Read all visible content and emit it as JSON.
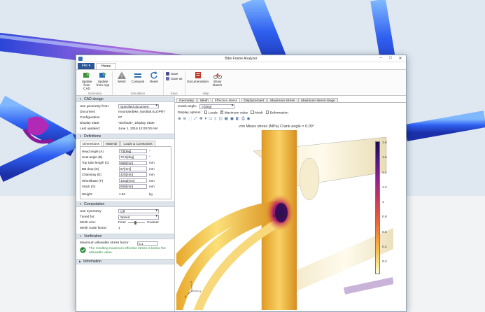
{
  "window": {
    "title": "Bike Frame Analyzer"
  },
  "ribbon": {
    "file_label": "File ▾",
    "home_label": "Home",
    "groups": [
      {
        "name": "Geometry",
        "buttons": [
          "Update from CAD",
          "Update from App"
        ]
      },
      {
        "name": "Simulation",
        "buttons": [
          "Mesh",
          "Compute",
          "Reset"
        ]
      },
      {
        "name": "Save",
        "buttons": [
          "Save",
          "Save as"
        ]
      },
      {
        "name": "Help",
        "buttons": [
          "Documentation",
          "Show sketch"
        ]
      }
    ]
  },
  "cad": {
    "header": "CAD design",
    "use_geometry_label": "Use geometry from:",
    "use_geometry_value": "Specified document",
    "document_label": "Document",
    "document_value": "mountainbike_hardtail.SLDPRT",
    "configuration_label": "Configuration",
    "configuration_value": "07",
    "display_state_label": "Display state:",
    "display_state_value": "<Default>_Display State",
    "last_updated_label": "Last updated:",
    "last_updated_value": "June 1, 2016    12:00:00 AM"
  },
  "definitions": {
    "header": "Definitions",
    "tabs": [
      "Dimensions",
      "Material",
      "Loads & Constraints"
    ],
    "rows": [
      {
        "label": "Head angle (A)",
        "value": "73[deg]",
        "unit": "°"
      },
      {
        "label": "Seat angle (B)",
        "value": "72.5[deg]",
        "unit": "°"
      },
      {
        "label": "Top tube length (C)",
        "value": "588[mm]",
        "unit": "mm"
      },
      {
        "label": "BB drop (D)",
        "value": "67[mm]",
        "unit": "mm"
      },
      {
        "label": "Chainstay (E)",
        "value": "425[mm]",
        "unit": "mm"
      },
      {
        "label": "Wheelbase (F)",
        "value": "1032[mm]",
        "unit": "mm"
      },
      {
        "label": "Stack (G)",
        "value": "608[mm]",
        "unit": "mm"
      }
    ],
    "weight_label": "Weight:",
    "weight_value": "1.63",
    "weight_unit": "kg"
  },
  "computation": {
    "header": "Computation",
    "symmetry_label": "Use symmetry",
    "symmetry_value": "Off",
    "tuned_label": "Tuned for:",
    "tuned_value": "Speed",
    "mesh_size_label": "Mesh size:",
    "mesh_finer": "Finer",
    "mesh_coarser": "Coarser",
    "mesh_slider_fraction": 0.45,
    "mesh_scale_label": "Mesh scale factor:",
    "mesh_scale_value": "1"
  },
  "verification": {
    "header": "Verification",
    "max_stress_label": "Maximum allowable stress factor:",
    "max_stress_value": "0.1",
    "message": "The resulting maximum effective stress is below the allowable value."
  },
  "information": {
    "header": "Information"
  },
  "main": {
    "tabs": [
      "Geometry",
      "Mesh",
      "Effective stress",
      "Displacement",
      "Maximum stress",
      "Maximum stress range"
    ],
    "active_tab": 2,
    "crank_label": "Crank angle:",
    "crank_value": "0 [deg]",
    "display_options_label": "Display options:",
    "options": [
      {
        "label": "Loads",
        "checked": false
      },
      {
        "label": "Maximum value",
        "checked": true
      },
      {
        "label": "Mesh",
        "checked": false
      },
      {
        "label": "Deformation",
        "checked": false
      }
    ],
    "plot_title": "von Mises stress (MPa)  Crank angle = 0.00°",
    "max_marker": "Max: 1.8",
    "colorbar_ticks": [
      "1.8",
      "1.6",
      "1.4",
      "1.2",
      "1",
      "0.8",
      "0.6",
      "0.4",
      "0.2"
    ],
    "axis_labels": {
      "x": "x",
      "y": "y",
      "z": "z"
    }
  },
  "colors": {
    "accent": "#2b5797",
    "section_header": "#dde3ea",
    "ok_green": "#2d8c3c"
  }
}
